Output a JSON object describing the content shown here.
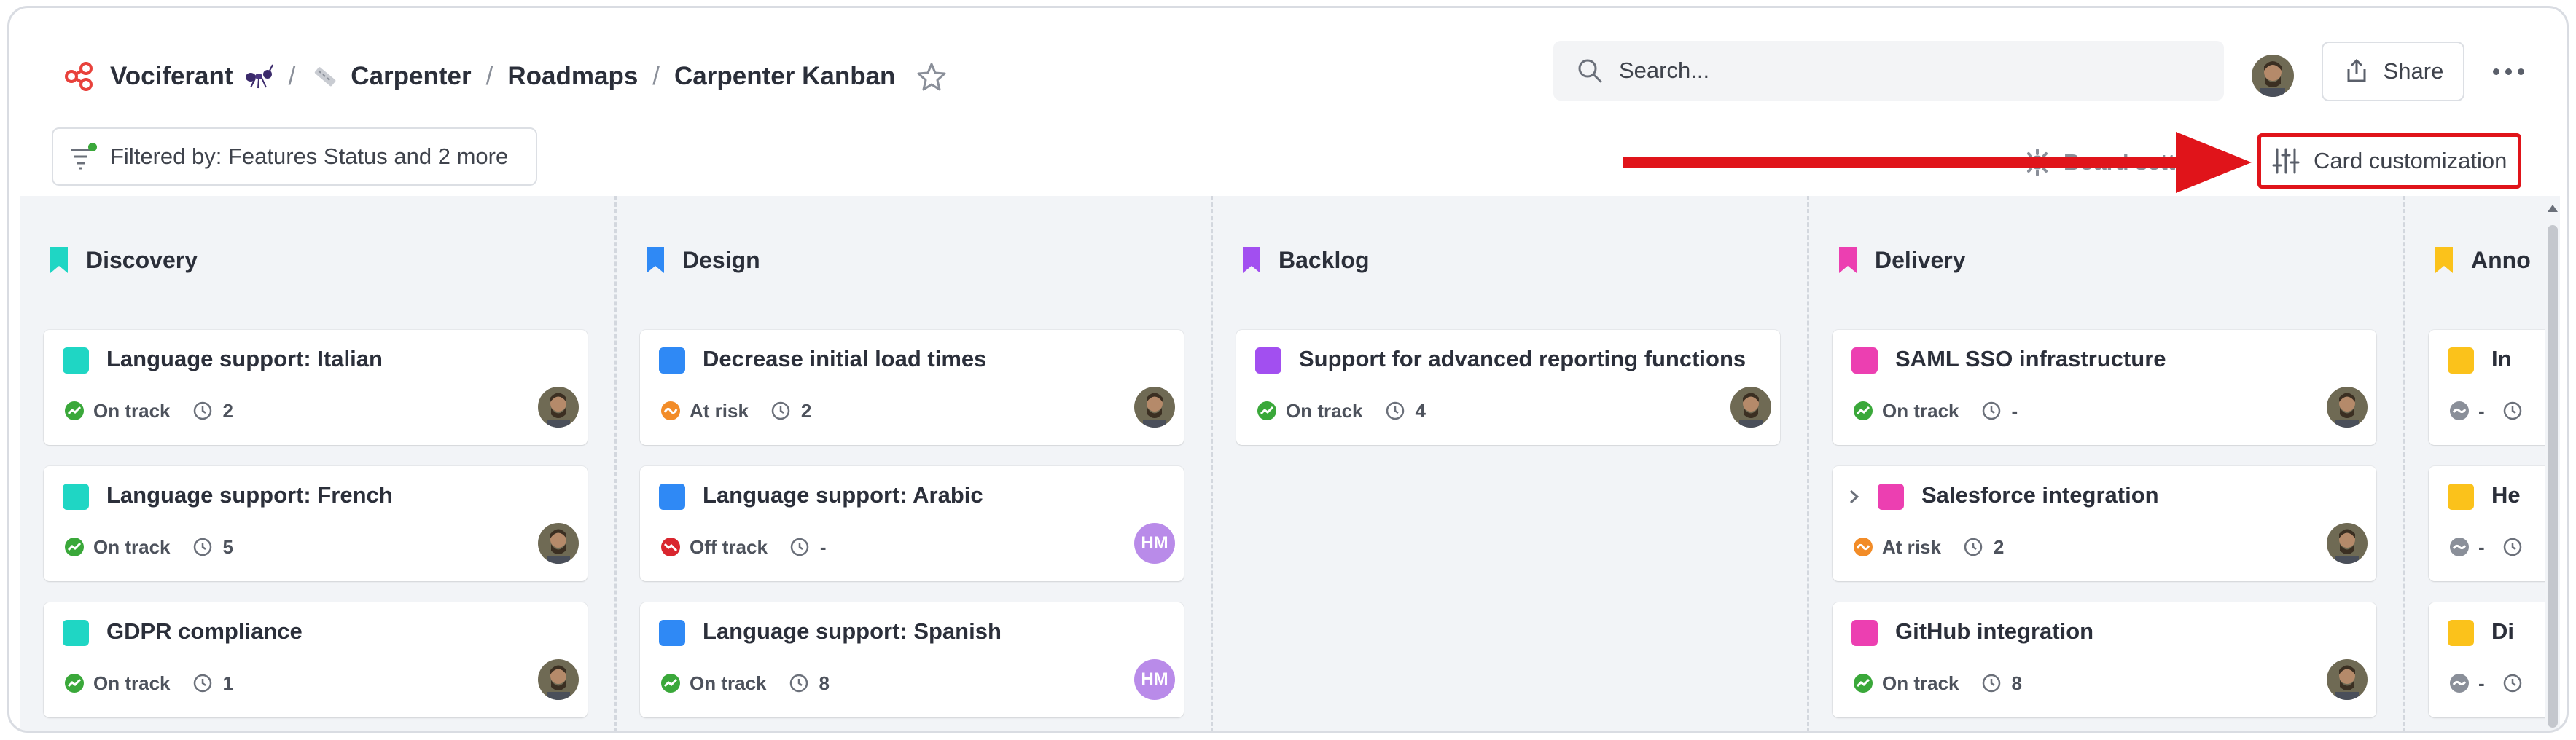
{
  "breadcrumb": {
    "workspace": "Vociferant",
    "workspace_emoji_icon": "ant-icon",
    "project": "Carpenter",
    "section": "Roadmaps",
    "page": "Carpenter Kanban",
    "separator": "/"
  },
  "search": {
    "placeholder": "Search..."
  },
  "header": {
    "share_label": "Share"
  },
  "toolbar": {
    "filter_label": "Filtered by: Features Status and 2 more",
    "board_settings_label": "Board settings",
    "card_customization_label": "Card customization"
  },
  "colors": {
    "annotation_red": "#e0141a",
    "discovery": "#1fd6c4",
    "design": "#2f89f5",
    "backlog": "#a24ff0",
    "delivery": "#ec3fb1",
    "announced": "#fbc21b",
    "on_track": "#3aa83a",
    "at_risk": "#f28c28",
    "off_track": "#d9262f"
  },
  "columns": [
    {
      "name": "Discovery",
      "cards": [
        {
          "title": "Language support: Italian",
          "status": "On track",
          "count": "2",
          "owner": "avatar"
        },
        {
          "title": "Language support: French",
          "status": "On track",
          "count": "5",
          "owner": "avatar"
        },
        {
          "title": "GDPR compliance",
          "status": "On track",
          "count": "1",
          "owner": "avatar"
        }
      ]
    },
    {
      "name": "Design",
      "cards": [
        {
          "title": "Decrease initial load times",
          "status": "At risk",
          "count": "2",
          "owner": "avatar"
        },
        {
          "title": "Language support: Arabic",
          "status": "Off track",
          "count": "-",
          "owner": "HM"
        },
        {
          "title": "Language support: Spanish",
          "status": "On track",
          "count": "8",
          "owner": "HM"
        }
      ]
    },
    {
      "name": "Backlog",
      "cards": [
        {
          "title": "Support for advanced reporting functions",
          "status": "On track",
          "count": "4",
          "owner": "avatar"
        }
      ]
    },
    {
      "name": "Delivery",
      "cards": [
        {
          "title": "SAML SSO infrastructure",
          "status": "On track",
          "count": "-",
          "owner": "avatar"
        },
        {
          "title": "Salesforce integration",
          "status": "At risk",
          "count": "2",
          "owner": "avatar"
        },
        {
          "title": "GitHub integration",
          "status": "On track",
          "count": "8",
          "owner": "avatar"
        }
      ]
    },
    {
      "name": "Anno",
      "cards": [
        {
          "title": "In",
          "status": "",
          "count": "-"
        },
        {
          "title": "He",
          "status": "",
          "count": "-"
        },
        {
          "title": "Di",
          "status": "",
          "count": "-"
        }
      ]
    }
  ]
}
